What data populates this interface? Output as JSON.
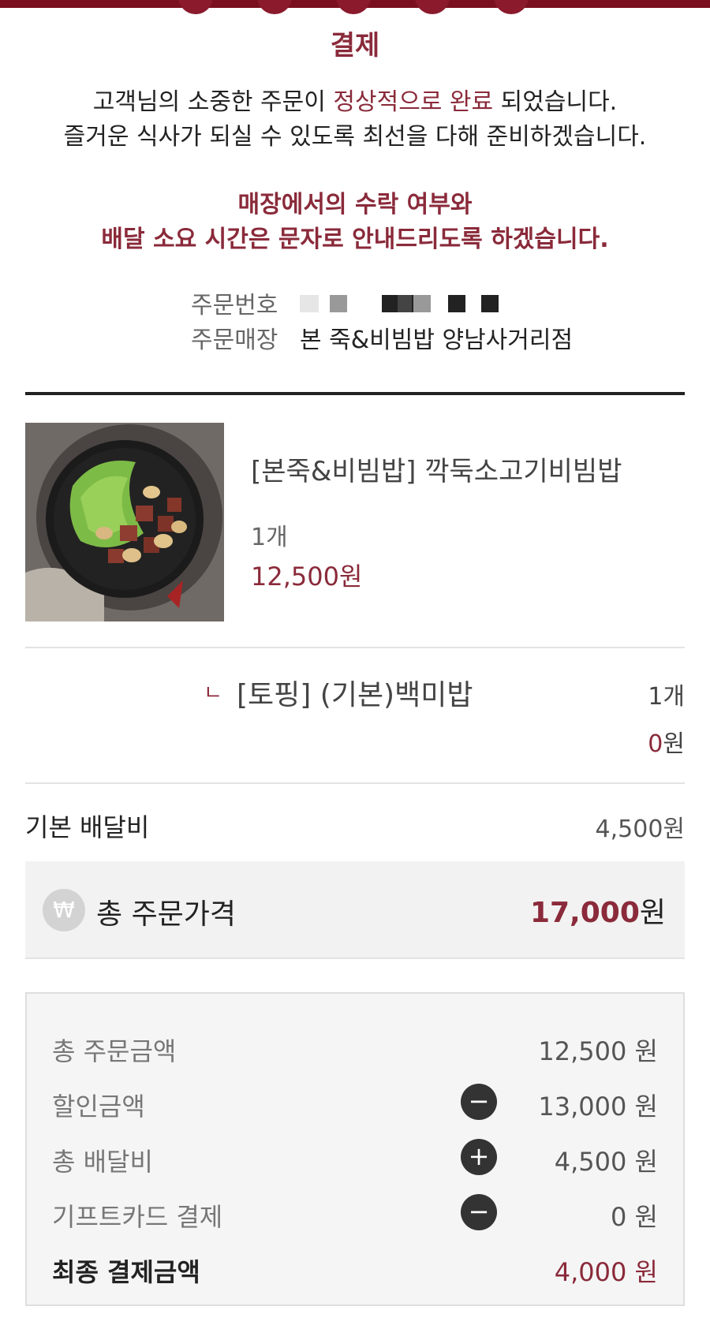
{
  "header": {
    "title": "결제"
  },
  "message": {
    "line1_pre": "고객님의 소중한 주문이 ",
    "line1_highlight": "정상적으로 완료",
    "line1_post": " 되었습니다.",
    "line2": "즐거운 식사가 되실 수 있도록 최선을 다해 준비하겠습니다."
  },
  "notice": {
    "line1": "매장에서의 수락 여부와",
    "line2": "배달 소요 시간은 문자로 안내드리도록 하겠습니다."
  },
  "order_info": {
    "number_label": "주문번호",
    "store_label": "주문매장",
    "store_value": "본 죽&비빔밥 양남사거리점"
  },
  "product": {
    "name": "[본죽&비빔밥] 깍둑소고기비빔밥",
    "qty": "1개",
    "price": "12,500원"
  },
  "topping": {
    "mark": "ㄴ",
    "name": "[토핑] (기본)백미밥",
    "qty": "1개",
    "price_num": "0",
    "price_unit": "원"
  },
  "delivery": {
    "label": "기본 배달비",
    "value": "4,500원"
  },
  "total": {
    "icon": "₩",
    "label": "총 주문가격",
    "value_num": "17,000",
    "value_unit": "원"
  },
  "summary": {
    "rows": [
      {
        "label": "총 주문금액",
        "value": "12,500 원"
      },
      {
        "label": "할인금액",
        "sign": "−",
        "value": "13,000 원"
      },
      {
        "label": "총 배달비",
        "sign": "+",
        "value": "4,500 원"
      },
      {
        "label": "기프트카드 결제",
        "sign": "−",
        "value": "0 원"
      },
      {
        "label": "최종 결제금액",
        "value": "4,000 원"
      }
    ]
  },
  "colors": {
    "accent": "#8a2a3a",
    "topbar": "#7a0f1f"
  }
}
